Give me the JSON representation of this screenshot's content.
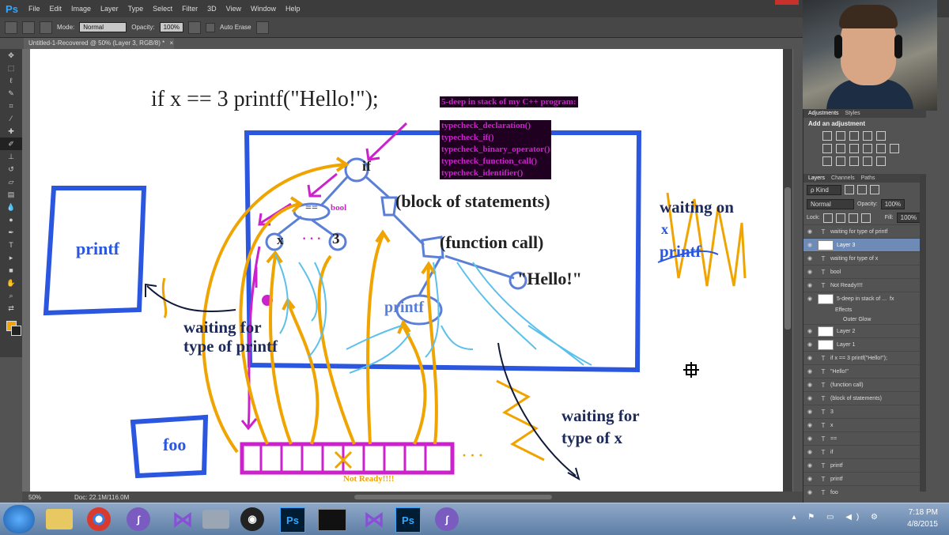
{
  "app": {
    "logo": "Ps",
    "menus": [
      "File",
      "Edit",
      "Image",
      "Layer",
      "Type",
      "Select",
      "Filter",
      "3D",
      "View",
      "Window",
      "Help"
    ]
  },
  "options": {
    "mode_label": "Mode:",
    "mode_value": "Normal",
    "opacity_label": "Opacity:",
    "opacity_value": "100%",
    "auto_erase": "Auto Erase"
  },
  "document": {
    "tab_title": "Untitled-1-Recovered @ 50% (Layer 3, RGB/8) *",
    "tab_close": "×"
  },
  "status": {
    "zoom": "50%",
    "doc_info": "Doc: 22.1M/116.0M"
  },
  "drawing": {
    "code_line": "if x == 3 printf(\"Hello!\");",
    "stack_title": "5-deep in stack of my C++ program:",
    "stack_items": [
      "typecheck_declaration()",
      "typecheck_if()",
      "typecheck_binary_operator()",
      "typecheck_function_call()",
      "typecheck_identifier()"
    ],
    "node_if": "if",
    "node_eq": "==",
    "bool": "bool",
    "node_x": "x",
    "node_dots": "· · ·",
    "node_3": "3",
    "block": "(block of statements)",
    "function_call": "(function call)",
    "hello": "\"Hello!\"",
    "printf_node": "printf",
    "printf_box": "printf",
    "foo_box": "foo",
    "waiting_printf": "waiting for\ntype of printf",
    "waiting_x": "waiting for\ntype of x",
    "waiting_on": "waiting on",
    "waiting_on_x": "x",
    "waiting_on_printf": "printf",
    "not_ready": "Not Ready!!!!",
    "queue_dots": "· · ·"
  },
  "panel": {
    "adjust_tabs": [
      "Adjustments",
      "Styles"
    ],
    "add_adjustment": "Add an adjustment",
    "layer_tabs": [
      "Layers",
      "Channels",
      "Paths"
    ],
    "kind": "ρ Kind",
    "blend_mode": "Normal",
    "opacity_label": "Opacity:",
    "opacity_value": "100%",
    "lock_label": "Lock:",
    "fill_label": "Fill:",
    "fill_value": "100%",
    "effects_label": "Effects",
    "outer_glow_label": "Outer Glow",
    "layers": [
      {
        "type": "T",
        "name": "waiting for type of printf"
      },
      {
        "type": "img",
        "name": "Layer 3",
        "selected": true
      },
      {
        "type": "T",
        "name": "waiting for type of x"
      },
      {
        "type": "T",
        "name": "bool"
      },
      {
        "type": "T",
        "name": "Not Ready!!!!"
      },
      {
        "type": "img",
        "name": "5-deep in stack of ...",
        "fx": "fx"
      },
      {
        "type": "img",
        "name": "Layer 2"
      },
      {
        "type": "img",
        "name": "Layer 1"
      },
      {
        "type": "T",
        "name": "if x == 3 printf(\"Hello!\");"
      },
      {
        "type": "T",
        "name": "\"Hello!\""
      },
      {
        "type": "T",
        "name": "(function call)"
      },
      {
        "type": "T",
        "name": "(block of statements)"
      },
      {
        "type": "T",
        "name": "3"
      },
      {
        "type": "T",
        "name": "x"
      },
      {
        "type": "T",
        "name": "=="
      },
      {
        "type": "T",
        "name": "if"
      },
      {
        "type": "T",
        "name": "printf"
      },
      {
        "type": "T",
        "name": "printf"
      },
      {
        "type": "T",
        "name": "foo"
      }
    ]
  },
  "taskbar": {
    "ps1": "Ps",
    "ps2": "Ps",
    "time": "7:18 PM",
    "date": "4/8/2015"
  },
  "colors": {
    "blue": "#2a56e0",
    "orange": "#f0a400",
    "magenta": "#cc22cc",
    "cyan": "#5bc0eb",
    "tree": "#5b7fd6"
  }
}
